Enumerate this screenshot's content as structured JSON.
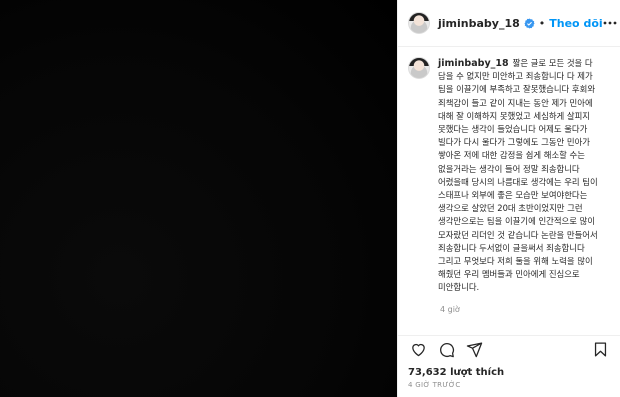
{
  "header": {
    "username": "jiminbaby_18",
    "separator": "•",
    "follow_label": "Theo dõi"
  },
  "caption": {
    "username": "jiminbaby_18",
    "text": "짧은 글로 모든 것을 다 담을 수 없지만 미안하고 죄송합니다 다 제가 팀을 이끌기에 부족하고 잘못했습니다 후회와 죄책감이 들고 같이 지내는 동안 제가 민아에 대해 잘 이해하지 못했었고 세심하게 살피지 못했다는 생각이 들었습니다 어제도 울다가 빌다가 다시 울다가 그렇에도 그동안 민아가 쌓아온 저에 대한 감정을 쉽게 해소할 수는 없을거라는 생각이 들어 정말 죄송합니다 어렸을때 당시의 나름대로 생각에는 우리 팀이 스태프나 외부에 좋은 모습만 보여야한다는 생각으로 살았던 20대 초반이었지만 그런 생각만으로는 팀을 이끌기에 인간적으로 많이 모자랐던 리더인 것 같습니다 논란을 만들어서 죄송합니다 두서없이 글을써서 죄송합니다 그리고 무엇보다 저희 둘을 위해 노력을 많이 해줬던 우리 멤버들과 민아에게 진심으로 미안합니다.",
    "time": "4 giờ"
  },
  "footer": {
    "likes": "73,632 lượt thích",
    "post_time": "4 GIỜ TRƯỚC"
  },
  "icons": {
    "verified": "verified-badge-icon",
    "more": "more-options-icon",
    "like": "heart-icon",
    "comment": "comment-icon",
    "share": "share-icon",
    "save": "bookmark-icon"
  },
  "colors": {
    "accent": "#0095f6",
    "text": "#262626",
    "muted": "#8e8e8e",
    "media_bg": "#000000"
  }
}
